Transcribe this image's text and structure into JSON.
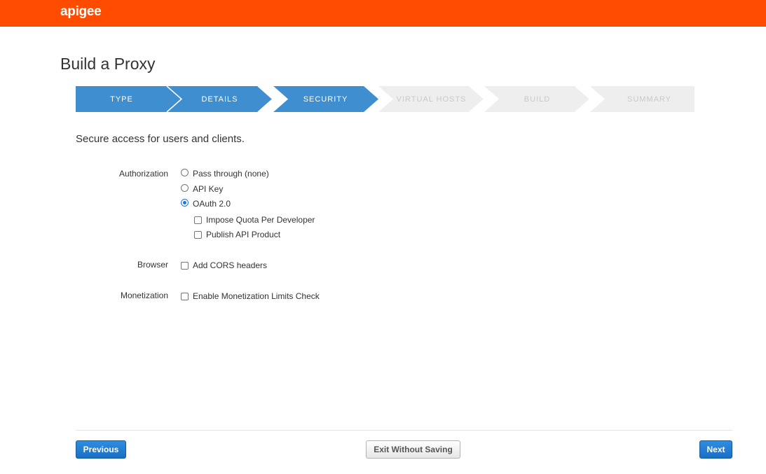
{
  "header": {
    "logo": "apigee"
  },
  "page": {
    "title": "Build a Proxy",
    "subtitle": "Secure access for users and clients."
  },
  "wizard": {
    "steps": [
      {
        "label": "TYPE",
        "state": "done"
      },
      {
        "label": "DETAILS",
        "state": "done"
      },
      {
        "label": "SECURITY",
        "state": "current"
      },
      {
        "label": "VIRTUAL HOSTS",
        "state": "pending"
      },
      {
        "label": "BUILD",
        "state": "pending"
      },
      {
        "label": "SUMMARY",
        "state": "pending"
      }
    ]
  },
  "form": {
    "authorization": {
      "label": "Authorization",
      "options": [
        {
          "label": "Pass through (none)",
          "checked": false
        },
        {
          "label": "API Key",
          "checked": false
        },
        {
          "label": "OAuth 2.0",
          "checked": true
        }
      ],
      "oauth_options": [
        {
          "label": "Impose Quota Per Developer",
          "checked": false
        },
        {
          "label": "Publish API Product",
          "checked": false
        }
      ]
    },
    "browser": {
      "label": "Browser",
      "option": {
        "label": "Add CORS headers",
        "checked": false
      }
    },
    "monetization": {
      "label": "Monetization",
      "option": {
        "label": "Enable Monetization Limits Check",
        "checked": false
      }
    }
  },
  "footer": {
    "previous_label": "Previous",
    "exit_label": "Exit Without Saving",
    "next_label": "Next"
  },
  "colors": {
    "brand": "#ff4c00",
    "step_active": "#3e8ed0",
    "step_inactive": "#eeeeee",
    "primary_button": "#1a6fc4"
  }
}
